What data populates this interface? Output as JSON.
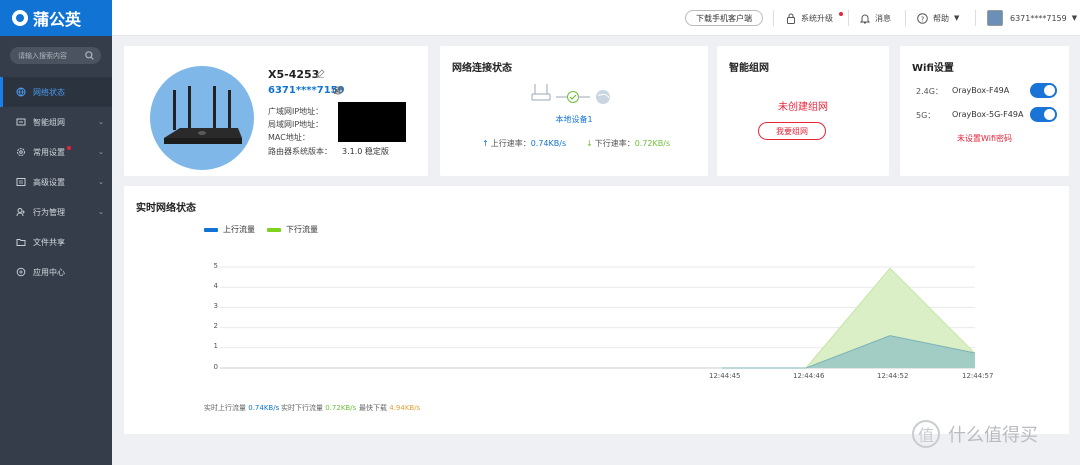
{
  "app": {
    "name": "蒲公英"
  },
  "header": {
    "download_button": "下载手机客户端",
    "upgrade": "系统升级",
    "messages": "消息",
    "help": "帮助",
    "account": "6371****7159"
  },
  "sidebar": {
    "search_placeholder": "请输入搜索内容",
    "items": [
      {
        "label": "网络状态",
        "icon": "globe-icon",
        "active": true
      },
      {
        "label": "智能组网",
        "icon": "network-icon"
      },
      {
        "label": "常用设置",
        "icon": "gear-icon",
        "badge": true
      },
      {
        "label": "高级设置",
        "icon": "sliders-icon"
      },
      {
        "label": "行为管理",
        "icon": "user-control-icon"
      },
      {
        "label": "文件共享",
        "icon": "folder-icon"
      },
      {
        "label": "应用中心",
        "icon": "apps-icon"
      }
    ]
  },
  "device": {
    "name": "X5-4253",
    "account": "6371****7159",
    "labels": [
      "广域网IP地址：",
      "局域网IP地址：",
      "MAC地址：",
      "路由器系统版本："
    ],
    "version": "3.1.0 稳定版"
  },
  "connection": {
    "title": "网络连接状态",
    "device_label": "本地设备1",
    "upload_label": "上行速率：",
    "upload_value": "0.74KB/s",
    "download_label": "下行速率：",
    "download_value": "0.72KB/s"
  },
  "mesh": {
    "title": "智能组网",
    "status": "未创建组网",
    "button": "我要组网"
  },
  "wifi": {
    "title": "Wifi设置",
    "bands": [
      {
        "band": "2.4G：",
        "ssid": "OrayBox-F49A",
        "enabled": true
      },
      {
        "band": "5G：",
        "ssid": "OrayBox-5G-F49A",
        "enabled": true
      }
    ],
    "no_password": "未设置Wifi密码"
  },
  "realtime": {
    "title": "实时网络状态",
    "summary": {
      "up_label": "实时上行流量",
      "up_value": "0.74KB/s",
      "down_label": "实时下行流量",
      "down_value": "0.72KB/s",
      "peak_label": "最快下载",
      "peak_value": "4.94KB/s"
    }
  },
  "chart_data": {
    "type": "area",
    "x": [
      "12:44:45",
      "12:44:46",
      "12:44:52",
      "12:44:57"
    ],
    "ylim": [
      0,
      5
    ],
    "yticks": [
      5,
      4,
      3,
      2,
      1,
      0
    ],
    "series": [
      {
        "name": "上行流量",
        "color": "#1173d4",
        "values": [
          0,
          0,
          1.6,
          0.74
        ]
      },
      {
        "name": "下行流量",
        "color": "#7ed321",
        "values": [
          0,
          0,
          4.94,
          0.72
        ]
      }
    ],
    "grid": true,
    "legend": "top-left"
  },
  "watermark": {
    "text": "什么值得买",
    "icon": "smzdm-logo"
  }
}
